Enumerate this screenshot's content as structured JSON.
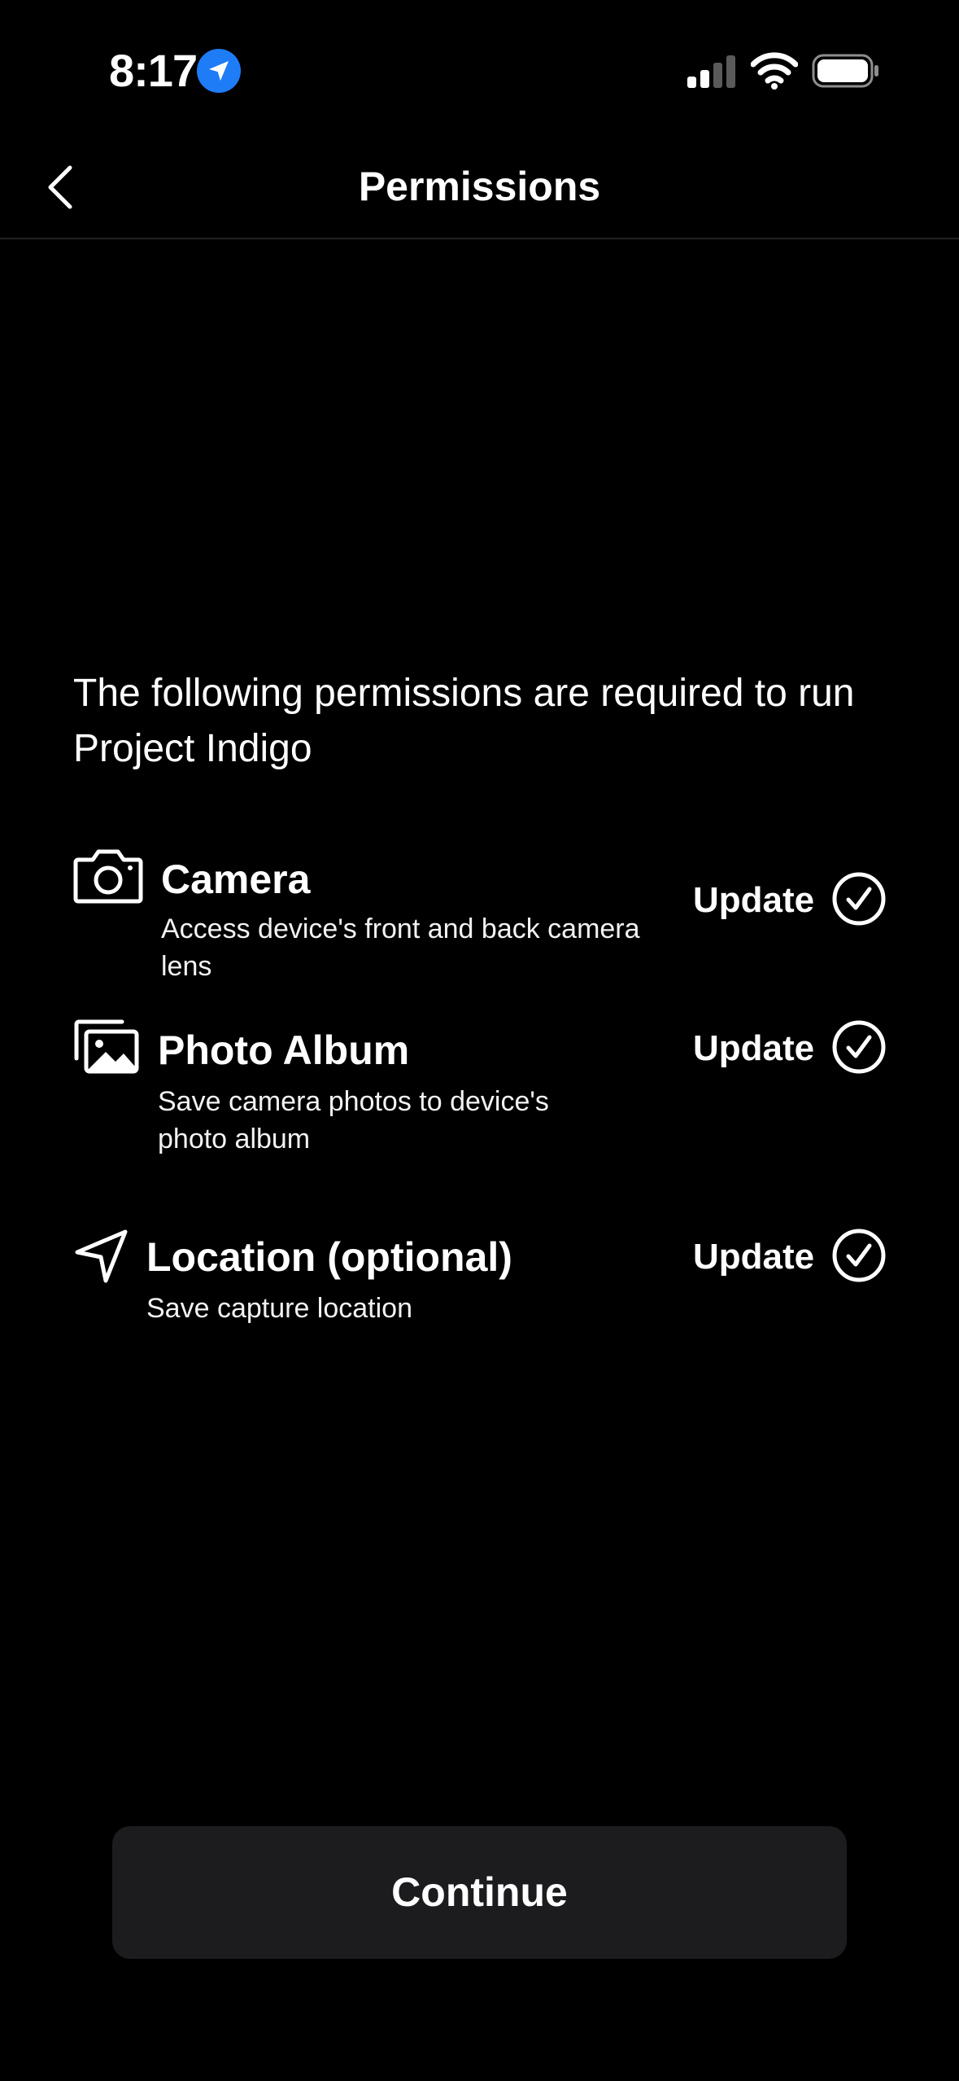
{
  "status_bar": {
    "time": "8:17"
  },
  "nav": {
    "title": "Permissions"
  },
  "intro": {
    "text": "The following permissions are required to run Project Indigo"
  },
  "permissions": [
    {
      "icon": "camera-icon",
      "title": "Camera",
      "description": "Access device's front and back camera lens",
      "action_label": "Update"
    },
    {
      "icon": "photo-album-icon",
      "title": "Photo Album",
      "description": "Save camera photos to device's photo album",
      "action_label": "Update"
    },
    {
      "icon": "location-arrow-icon",
      "title": "Location (optional)",
      "description": "Save capture location",
      "action_label": "Update"
    }
  ],
  "footer": {
    "continue_label": "Continue"
  },
  "colors": {
    "background": "#000000",
    "text": "#ffffff",
    "button_background": "#1c1c1e",
    "location_badge": "#1e7cf7",
    "divider": "#222222"
  }
}
